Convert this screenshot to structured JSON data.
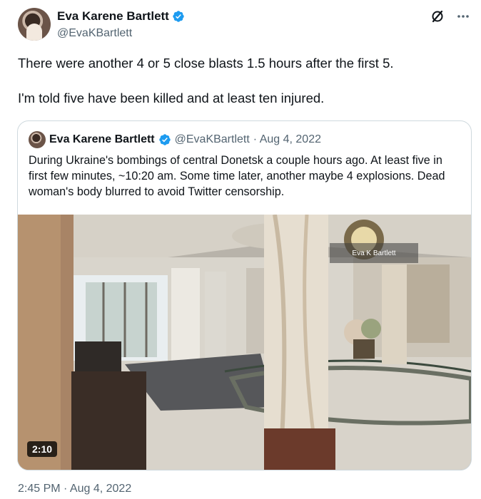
{
  "author": {
    "name": "Eva Karene Bartlett",
    "handle": "@EvaKBartlett"
  },
  "icons": {
    "top": [
      "grok-icon",
      "more-icon"
    ],
    "verified": "verified-badge-icon"
  },
  "tweet": {
    "paragraphs": [
      "There were another 4 or 5 close blasts 1.5 hours after the first 5.",
      "I'm told five have been killed and at least ten injured."
    ],
    "timestamp": "2:45 PM · Aug 4, 2022"
  },
  "quote": {
    "name": "Eva Karene Bartlett",
    "handle": "@EvaKBartlett",
    "date": "· Aug 4, 2022",
    "text": "During Ukraine's bombings of central Donetsk a couple hours ago.  At least five in first few minutes, ~10:20 am.  Some time later, another maybe 4 explosions. Dead woman's body blurred to avoid Twitter censorship.",
    "video": {
      "duration": "2:10",
      "watermark": "Eva K Bartlett"
    }
  },
  "colors": {
    "text": "#0f1419",
    "secondary": "#536471",
    "verified": "#1d9bf0",
    "border": "#cfd9de"
  }
}
